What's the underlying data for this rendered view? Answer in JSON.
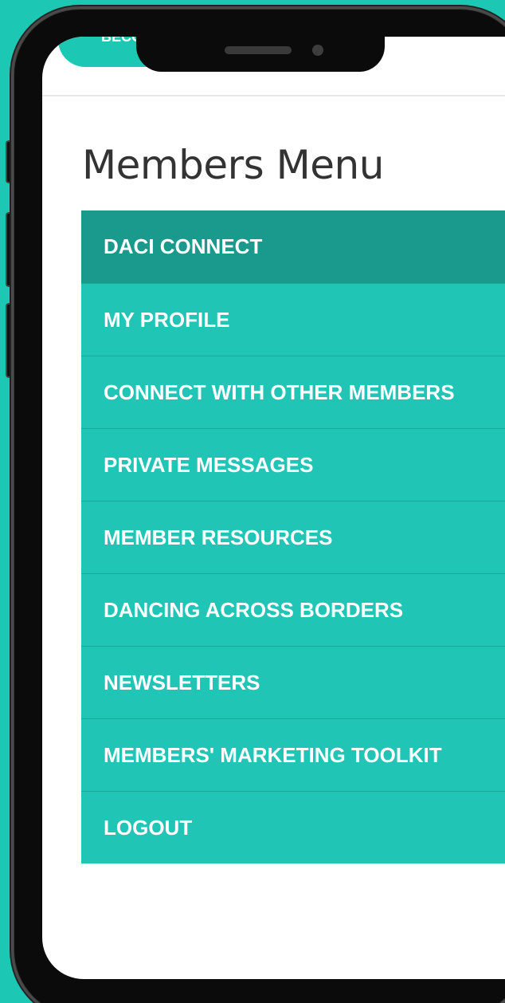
{
  "header": {
    "button_label": "BECO"
  },
  "page": {
    "title": "Members Menu"
  },
  "menu": {
    "items": [
      {
        "label": "DACI CONNECT",
        "active": true
      },
      {
        "label": "MY PROFILE",
        "active": false
      },
      {
        "label": "CONNECT WITH OTHER MEMBERS",
        "active": false
      },
      {
        "label": "PRIVATE MESSAGES",
        "active": false
      },
      {
        "label": "MEMBER RESOURCES",
        "active": false
      },
      {
        "label": "DANCING ACROSS BORDERS",
        "active": false
      },
      {
        "label": "NEWSLETTERS",
        "active": false
      },
      {
        "label": "MEMBERS' MARKETING TOOLKIT",
        "active": false
      },
      {
        "label": "LOGOUT",
        "active": false
      }
    ]
  },
  "colors": {
    "background": "#1cc8b4",
    "menu_item": "#20c5b6",
    "menu_item_active": "#1a9a8d",
    "phone_frame": "#0b0b0b",
    "title_text": "#333333"
  }
}
